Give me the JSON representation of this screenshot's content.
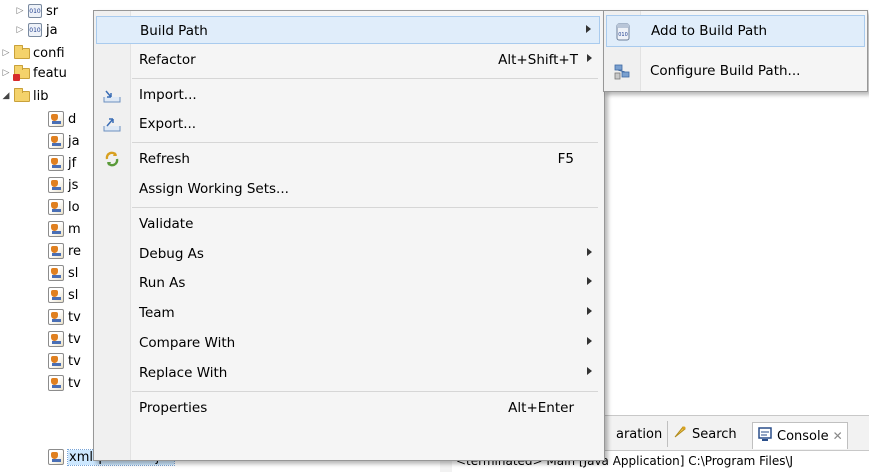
{
  "tree": {
    "rows": [
      {
        "label": "sr",
        "kind": "pkgjar",
        "twisty": "closed"
      },
      {
        "label": "ja",
        "kind": "pkgjar",
        "twisty": "closed"
      },
      {
        "label": "confi",
        "kind": "folder",
        "twisty": "closed"
      },
      {
        "label": "featu",
        "kind": "folder-error",
        "twisty": "closed"
      },
      {
        "label": "lib",
        "kind": "folder",
        "twisty": "open"
      },
      {
        "label": "d",
        "kind": "jar"
      },
      {
        "label": "ja",
        "kind": "jar"
      },
      {
        "label": "jf",
        "kind": "jar"
      },
      {
        "label": "js",
        "kind": "jar"
      },
      {
        "label": "lo",
        "kind": "jar"
      },
      {
        "label": "m",
        "kind": "jar"
      },
      {
        "label": "re",
        "kind": "jar"
      },
      {
        "label": "sl",
        "kind": "jar"
      },
      {
        "label": "sl",
        "kind": "jar"
      },
      {
        "label": "tv",
        "kind": "jar"
      },
      {
        "label": "tv",
        "kind": "jar"
      },
      {
        "label": "tv",
        "kind": "jar"
      },
      {
        "label": "tv",
        "kind": "jar"
      },
      {
        "label": "xmlrpc-1.1.1.jar",
        "kind": "jar",
        "selected": true
      }
    ]
  },
  "context_menu": {
    "items": [
      {
        "label": "Build Path",
        "shortcut": "",
        "submenu": true,
        "icon": "",
        "hover": true
      },
      {
        "label": "Refactor",
        "shortcut": "Alt+Shift+T",
        "submenu": true,
        "icon": ""
      },
      {
        "separator": true
      },
      {
        "label": "Import...",
        "shortcut": "",
        "icon": "import-icon"
      },
      {
        "label": "Export...",
        "shortcut": "",
        "icon": "export-icon"
      },
      {
        "separator": true
      },
      {
        "label": "Refresh",
        "shortcut": "F5",
        "icon": "refresh-icon"
      },
      {
        "label": "Assign Working Sets...",
        "shortcut": "",
        "icon": ""
      },
      {
        "separator": true
      },
      {
        "label": "Validate",
        "shortcut": "",
        "icon": ""
      },
      {
        "label": "Debug As",
        "shortcut": "",
        "submenu": true,
        "icon": ""
      },
      {
        "label": "Run As",
        "shortcut": "",
        "submenu": true,
        "icon": ""
      },
      {
        "label": "Team",
        "shortcut": "",
        "submenu": true,
        "icon": ""
      },
      {
        "label": "Compare With",
        "shortcut": "",
        "submenu": true,
        "icon": ""
      },
      {
        "label": "Replace With",
        "shortcut": "",
        "submenu": true,
        "icon": ""
      },
      {
        "separator": true
      },
      {
        "label": "Properties",
        "shortcut": "Alt+Enter",
        "icon": ""
      }
    ]
  },
  "submenu": {
    "items": [
      {
        "label": "Add to Build Path",
        "icon": "add-to-build-path-icon",
        "hover": true
      },
      {
        "label": "Configure Build Path...",
        "icon": "configure-build-path-icon"
      }
    ]
  },
  "console_panel": {
    "tabs": [
      {
        "label": "aration",
        "icon": ""
      },
      {
        "label": "Search",
        "icon": "search-icon"
      },
      {
        "label": "Console",
        "icon": "console-icon"
      }
    ],
    "status_line": "<terminated> Main [Java Application] C:\\Program Files\\J"
  },
  "colors": {
    "menu_bg": "#f5f5f5",
    "menu_border": "#979797",
    "hover_bg": "#e0edfa",
    "hover_border": "#a9cbee",
    "selection_bg": "#cde8ff"
  }
}
